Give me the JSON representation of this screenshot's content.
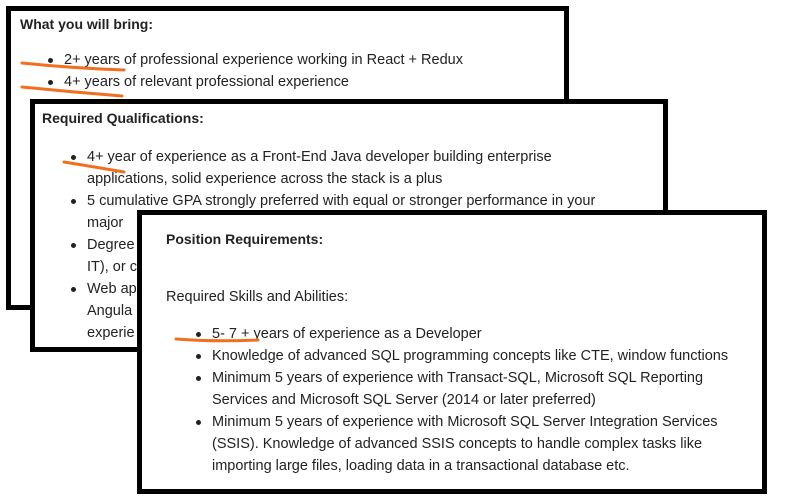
{
  "card1": {
    "heading": "What you will bring:",
    "items": [
      "2+ years of professional experience working in React + Redux",
      "4+ years of relevant professional experience"
    ]
  },
  "card2": {
    "heading": "Required Qualifications:",
    "item1_line1": "4+ year of experience as a Front-End Java developer building enterprise",
    "item1_line2": "applications, solid experience across the stack is a plus",
    "item2_line1": "5 cumulative GPA strongly preferred with equal or stronger performance in your",
    "item2_line2": "major",
    "item3_line1": "Degree",
    "item3_line2": "IT), or c",
    "item4_line1": "Web ap",
    "item4_line2": "Angula",
    "item4_line3": "experie"
  },
  "card3": {
    "heading": "Position Requirements:",
    "subheading": "Required Skills and Abilities:",
    "item1": "5- 7 + years of experience as a Developer",
    "item2": "Knowledge of advanced SQL programming concepts like CTE, window functions",
    "item3_line1": "Minimum 5 years of experience with Transact-SQL, Microsoft SQL Reporting",
    "item3_line2": "Services and Microsoft SQL Server (2014 or later preferred)",
    "item4_line1": "Minimum 5 years of experience with Microsoft SQL Server Integration Services",
    "item4_line2": "(SSIS). Knowledge of advanced SSIS concepts to handle complex tasks like",
    "item4_line3": "importing large files, loading data in a transactional database etc."
  },
  "colors": {
    "border": "#000000",
    "highlight": "#f07020",
    "text": "#222222"
  }
}
